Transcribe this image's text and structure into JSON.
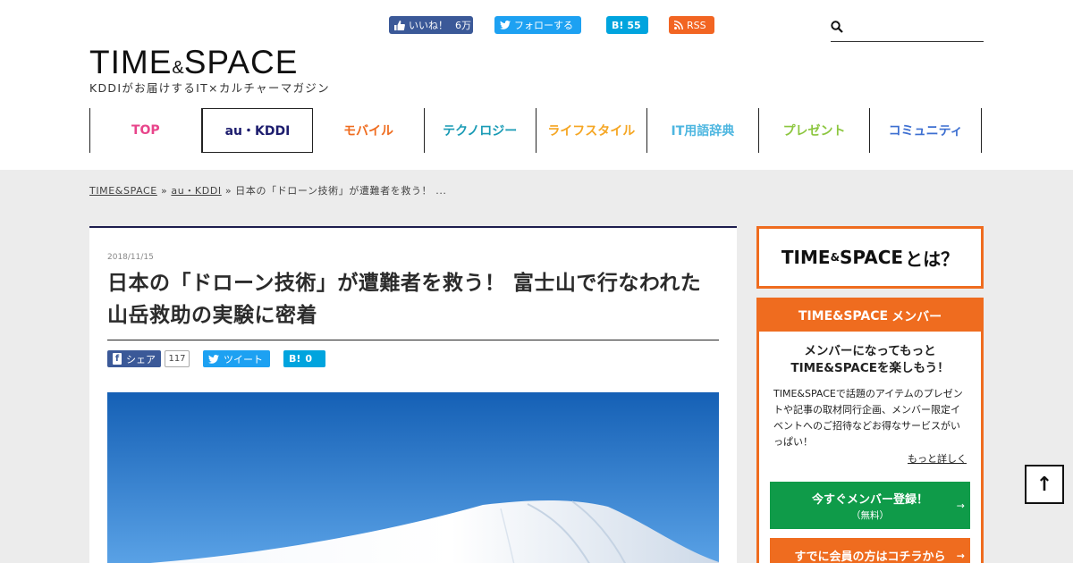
{
  "header": {
    "facebook": {
      "label": "いいね！",
      "count": "6万"
    },
    "twitter": {
      "label": "フォローする"
    },
    "hatena": {
      "icon_text": "B!",
      "count": "55"
    },
    "rss": {
      "label": "RSS"
    },
    "logo": {
      "part1": "TIME",
      "amp": "&",
      "part2": "SPACE"
    },
    "tagline": "KDDIがお届けするIT×カルチャーマガジン",
    "search": {
      "placeholder": "",
      "value": ""
    }
  },
  "nav": {
    "items": [
      {
        "label": "TOP",
        "color": "#e8458b"
      },
      {
        "label": "au・KDDI",
        "color": "#1d1d6e"
      },
      {
        "label": "モバイル",
        "color": "#ef6c1f"
      },
      {
        "label": "テクノロジー",
        "color": "#1a9bb5"
      },
      {
        "label": "ライフスタイル",
        "color": "#f5a623"
      },
      {
        "label": "IT用語辞典",
        "color": "#4db6e0"
      },
      {
        "label": "プレゼント",
        "color": "#8cc63f"
      },
      {
        "label": "コミュニティ",
        "color": "#3d6fd1"
      }
    ],
    "active_index": 1
  },
  "breadcrumb": {
    "home": "TIME&SPACE",
    "sep1": "»",
    "category": "au・KDDI",
    "sep2": "»",
    "current": "日本の「ドローン技術」が遭難者を救う！ ..."
  },
  "article": {
    "date": "2018/11/15",
    "title": "日本の「ドローン技術」が遭難者を救う！ 富士山で行なわれた山岳救助の実験に密着",
    "share": {
      "facebook_label": "シェア",
      "facebook_count": "117",
      "twitter_label": "ツイート",
      "hatena_icon": "B!",
      "hatena_count": "0"
    }
  },
  "sidebar": {
    "about": {
      "logo1": "TIME",
      "amp": "&",
      "logo2": "SPACE",
      "suffix": "とは？"
    },
    "member": {
      "header_logo": "TIME&SPACE",
      "header_suffix": "メンバー",
      "title_line1": "メンバーになってもっと",
      "title_line2": "TIME&SPACEを楽しもう！",
      "body": "TIME&SPACEで話題のアイテムのプレゼントや記事の取材同行企画、メンバー限定イベントへのご招待などお得なサービスがいっぱい！",
      "more_link": "もっと詳しく",
      "register_label": "今すぐメンバー登録！",
      "register_sub": "（無料）",
      "login_label": "すでに会員の方はコチラから",
      "arrow": "→"
    }
  },
  "to_top": {
    "icon": "↑"
  },
  "colors": {
    "accent_orange": "#ef6c1f",
    "register_green": "#0f9b49",
    "navy": "#1d1d4e"
  }
}
